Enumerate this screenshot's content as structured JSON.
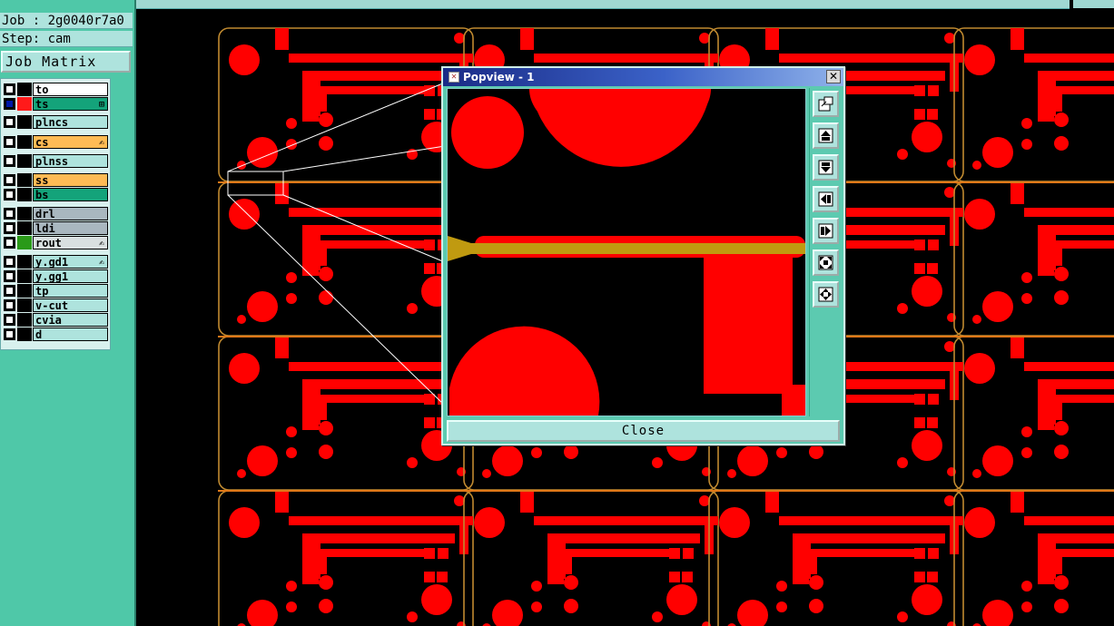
{
  "job_label": "Job : 2g0040r7a0",
  "step_label": "Step: cam",
  "job_matrix_button": "Job Matrix ...",
  "layers": [
    {
      "name": "to",
      "color": "#ffffff",
      "swatch": "#000000",
      "checked": false,
      "mark": ""
    },
    {
      "name": "ts",
      "color": "#14a37a",
      "swatch": "#ff1a1a",
      "checked": true,
      "mark": "⊞"
    },
    {
      "name": "plncs",
      "color": "#aee3dd",
      "swatch": "#000000",
      "checked": false,
      "mark": ""
    },
    {
      "name": "cs",
      "color": "#ffbb55",
      "swatch": "#000000",
      "checked": false,
      "mark": "✍"
    },
    {
      "name": "plnss",
      "color": "#aee3dd",
      "swatch": "#000000",
      "checked": false,
      "mark": ""
    },
    {
      "name": "ss",
      "color": "#ffbb55",
      "swatch": "#000000",
      "checked": false,
      "mark": ""
    },
    {
      "name": "bs",
      "color": "#14a37a",
      "swatch": "#000000",
      "checked": false,
      "mark": ""
    },
    {
      "name": "drl",
      "color": "#a9b7bf",
      "swatch": "#000000",
      "checked": false,
      "mark": ""
    },
    {
      "name": "ldi",
      "color": "#a9b7bf",
      "swatch": "#000000",
      "checked": false,
      "mark": ""
    },
    {
      "name": "rout",
      "color": "#d9e0e0",
      "swatch": "#2a9a18",
      "checked": false,
      "mark": "✍"
    },
    {
      "name": "y.gd1",
      "color": "#aee3dd",
      "swatch": "#000000",
      "checked": false,
      "mark": "✍"
    },
    {
      "name": "y.gg1",
      "color": "#aee3dd",
      "swatch": "#000000",
      "checked": false,
      "mark": ""
    },
    {
      "name": "tp",
      "color": "#aee3dd",
      "swatch": "#000000",
      "checked": false,
      "mark": ""
    },
    {
      "name": "v-cut",
      "color": "#aee3dd",
      "swatch": "#000000",
      "checked": false,
      "mark": ""
    },
    {
      "name": "cvia",
      "color": "#aee3dd",
      "swatch": "#000000",
      "checked": false,
      "mark": ""
    },
    {
      "name": "d",
      "color": "#aee3dd",
      "swatch": "#000000",
      "checked": false,
      "mark": ""
    }
  ],
  "popview": {
    "title": "Popview - 1",
    "close_label": "Close",
    "close_x": "✕",
    "tools": [
      "zoom-window-icon",
      "pan-up-icon",
      "pan-down-icon",
      "pan-left-icon",
      "pan-right-icon",
      "zoom-fit-icon",
      "zoom-in-icon"
    ]
  },
  "colors": {
    "copper": "#ff0000",
    "outline": "#c08a30",
    "selected_trace": "#c09a10",
    "panel": "#4fc8a8"
  }
}
